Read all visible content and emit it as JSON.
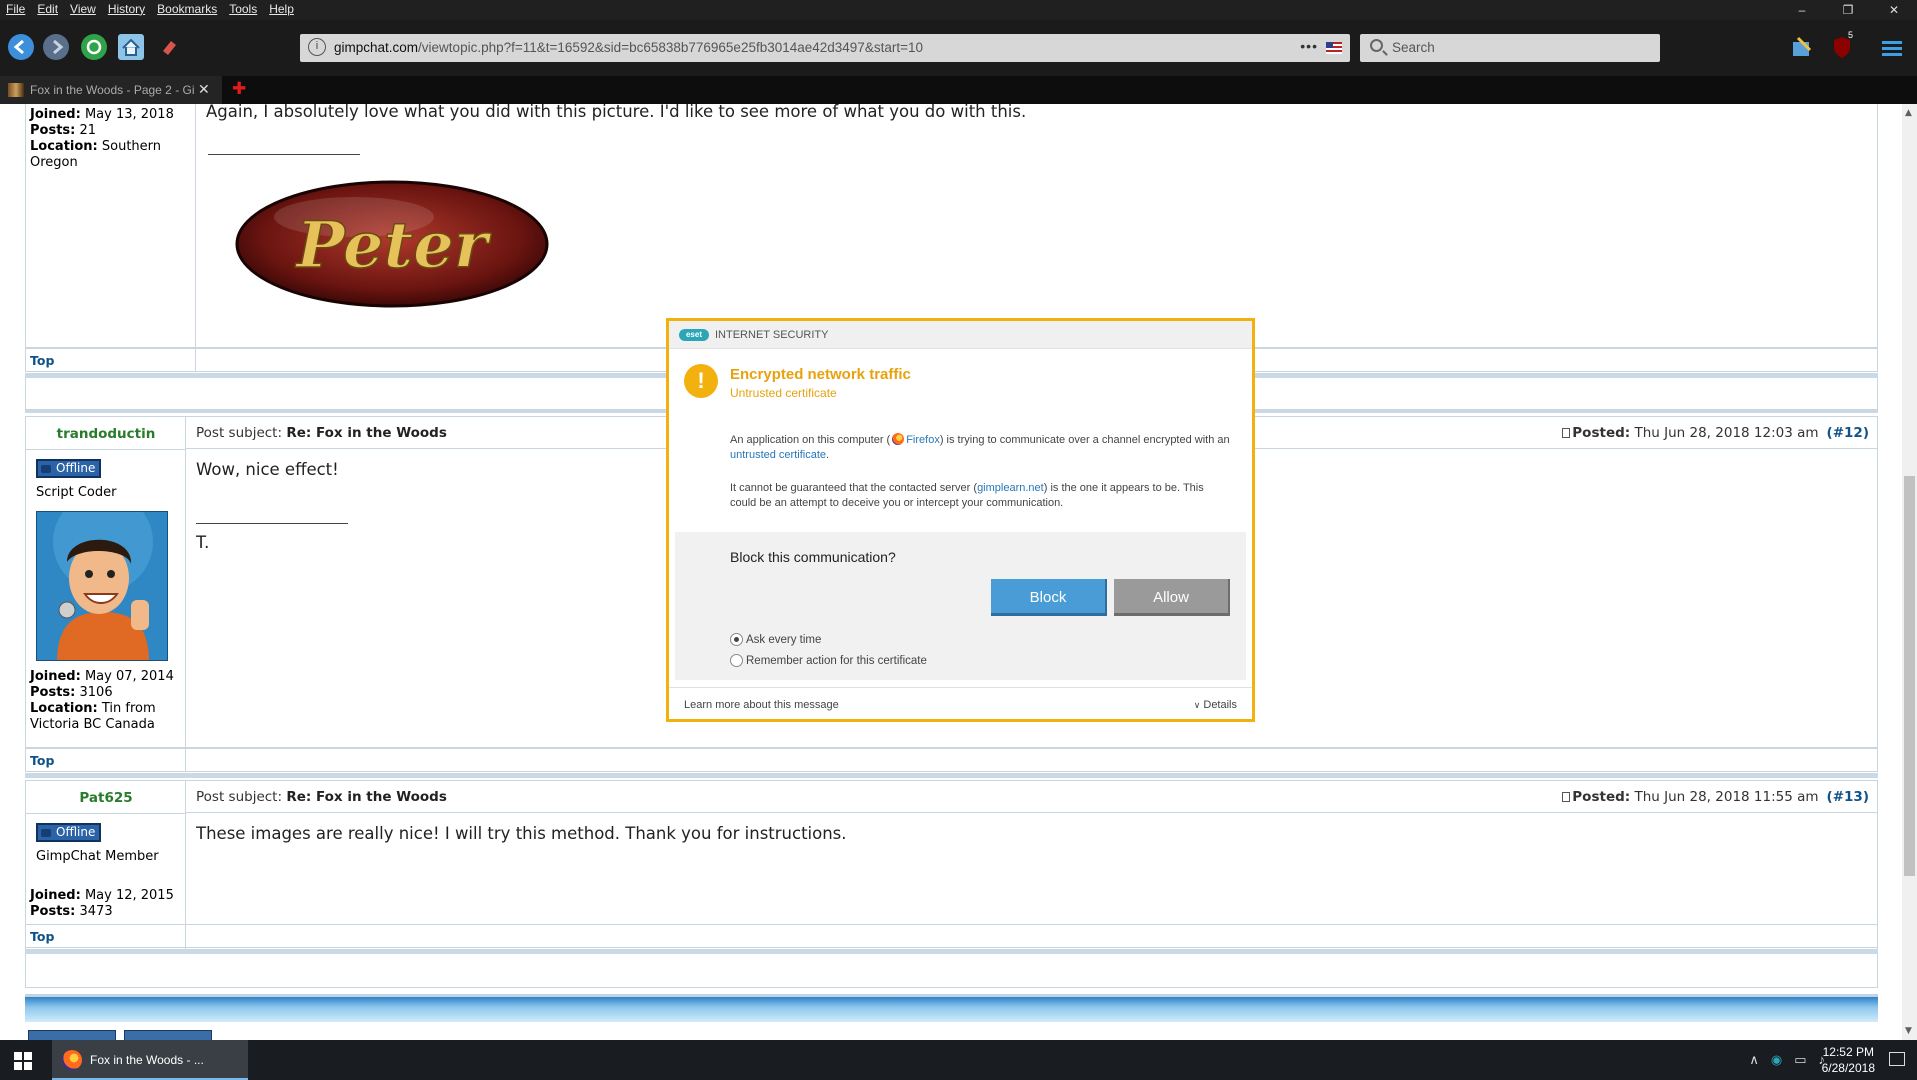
{
  "menubar": {
    "items": [
      "File",
      "Edit",
      "View",
      "History",
      "Bookmarks",
      "Tools",
      "Help"
    ],
    "window_controls": [
      "–",
      "❐",
      "✕"
    ]
  },
  "navbar": {
    "url_domain": "gimpchat.com",
    "url_rest": "/viewtopic.php?f=11&t=16592&sid=bc65838b776965e25fb3014ae42d3497&start=10",
    "page_actions": "•••",
    "search_placeholder": "Search",
    "ublock_badge": "5"
  },
  "tabs": [
    {
      "title": "Fox in the Woods - Page 2 - Gi",
      "close": "✕"
    }
  ],
  "new_tab_symbol": "✚",
  "posts": [
    {
      "joined_label": "Joined:",
      "joined": "May 13, 2018",
      "posts_label": "Posts:",
      "posts": "21",
      "location_label": "Location:",
      "location": "Southern Oregon",
      "body": "Again, I absolutely love what you did with this picture. I'd like to see more of what you do with this.",
      "signature_logo_text": "Peter",
      "top_link": "Top"
    },
    {
      "author": "trandoductin",
      "status": "Offline",
      "rank": "Script Coder",
      "subject_label": "Post subject:",
      "subject": "Re: Fox in the Woods",
      "posted_label": "Posted:",
      "posted": "Thu Jun 28, 2018 12:03 am",
      "post_number": "(#12)",
      "body": "Wow, nice effect!",
      "signature": "T.",
      "joined_label": "Joined:",
      "joined": "May 07, 2014",
      "posts_label": "Posts:",
      "posts": "3106",
      "location_label": "Location:",
      "location": "Tin from Victoria BC Canada",
      "top_link": "Top"
    },
    {
      "author": "Pat625",
      "status": "Offline",
      "rank": "GimpChat Member",
      "subject_label": "Post subject:",
      "subject": "Re: Fox in the Woods",
      "posted_label": "Posted:",
      "posted": "Thu Jun 28, 2018 11:55 am",
      "post_number": "(#13)",
      "body": "These images are really nice! I will try this method. Thank you for instructions.",
      "joined_label": "Joined:",
      "joined": "May 12, 2015",
      "posts_label": "Posts:",
      "posts": "3473",
      "top_link": "Top"
    }
  ],
  "eset_dialog": {
    "logo": "eset",
    "product": "INTERNET SECURITY",
    "title": "Encrypted network traffic",
    "subtitle": "Untrusted certificate",
    "p1_a": "An application on this computer (",
    "p1_app": "Firefox",
    "p1_b": ") is trying to communicate over a channel encrypted with an ",
    "p1_link": "untrusted certificate",
    "p1_c": ".",
    "p2_a": "It cannot be guaranteed that the contacted server (",
    "p2_server": "gimplearn.net",
    "p2_b": ") is the one it appears to be. This could be an attempt to deceive you or intercept your communication.",
    "question": "Block this communication?",
    "block_label": "Block",
    "allow_label": "Allow",
    "radio_ask": "Ask every time",
    "radio_remember": "Remember action for this certificate",
    "learn_more": "Learn more about this message",
    "details": "Details",
    "colors": {
      "accent": "#f2b10e",
      "block": "#4a9cd7",
      "allow": "#9a9a9a"
    }
  },
  "taskbar": {
    "task_label": "Fox in the Woods - ...",
    "time": "12:52 PM",
    "date": "6/28/2018"
  },
  "colors": {
    "author_green": "#287c2c",
    "link_blue": "#105289",
    "offline_badge": "#2a63a8"
  }
}
